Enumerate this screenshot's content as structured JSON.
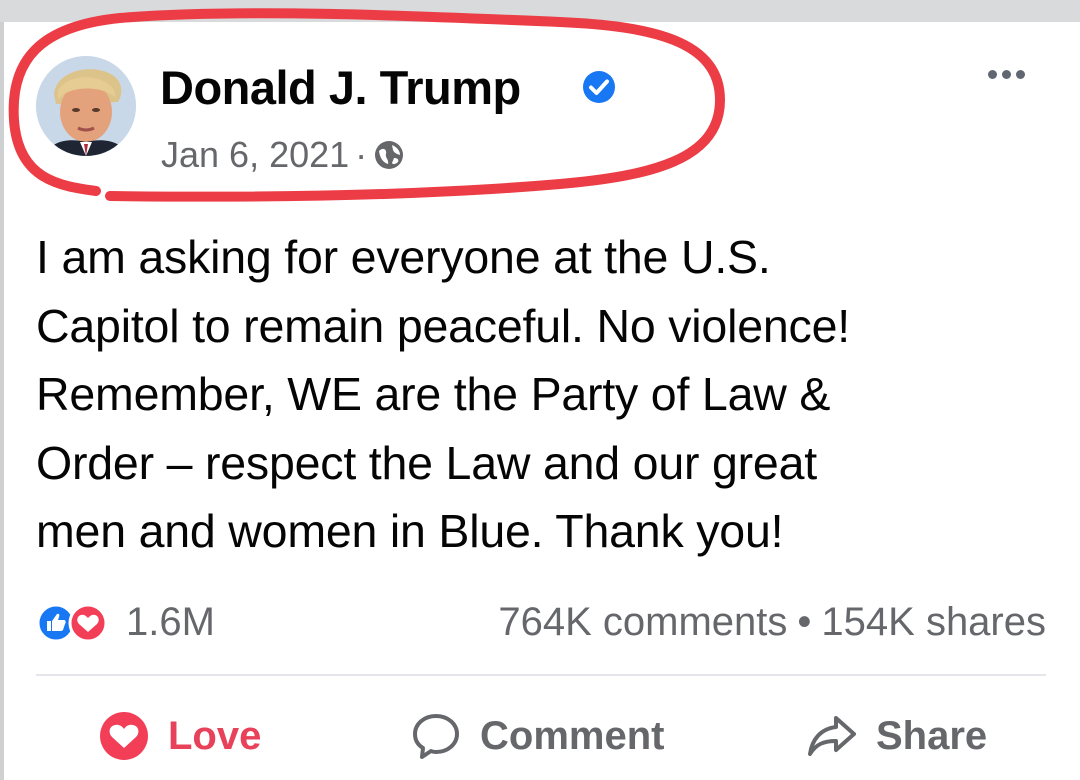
{
  "post": {
    "author": "Donald J. Trump",
    "verified": true,
    "date": "Jan 6, 2021",
    "separator": "·",
    "privacy_icon": "globe-icon",
    "more_icon": "more-options-icon",
    "text": "I am asking for everyone at the U.S.\nCapitol to remain peaceful. No violence!\nRemember, WE are the Party of Law &\nOrder – respect the Law and our great\nmen and women in Blue. Thank you!"
  },
  "stats": {
    "reaction_icons": [
      "like-icon",
      "love-icon"
    ],
    "reactions_count": "1.6M",
    "comments": "764K comments",
    "bullet": "•",
    "shares": "154K shares"
  },
  "actions": {
    "love_label": "Love",
    "comment_label": "Comment",
    "share_label": "Share"
  },
  "colors": {
    "highlight": "#ec3d46",
    "love": "#e8415a",
    "like": "#1877f2",
    "verified": "#1877f2",
    "meta_text": "#65676b"
  }
}
